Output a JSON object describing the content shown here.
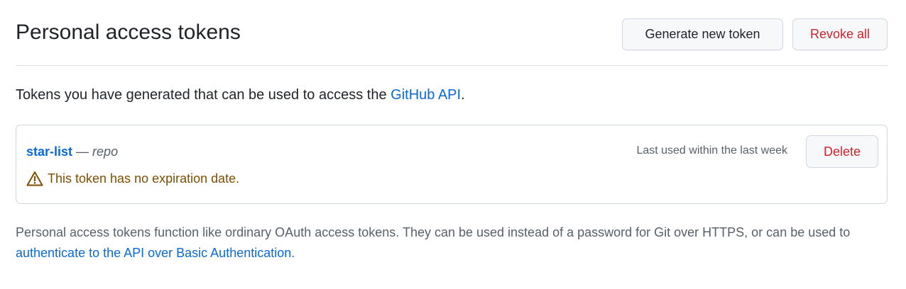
{
  "header": {
    "title": "Personal access tokens",
    "generate_label": "Generate new token",
    "revoke_label": "Revoke all"
  },
  "intro": {
    "text_before": "Tokens you have generated that can be used to access the ",
    "link_text": "GitHub API",
    "text_after": "."
  },
  "tokens": [
    {
      "name": "star-list",
      "separator": " — ",
      "scope": "repo",
      "last_used": "Last used within the last week",
      "delete_label": "Delete",
      "warning_icon": "alert-triangle-icon",
      "warning": "This token has no expiration date."
    }
  ],
  "footer": {
    "text_before": "Personal access tokens function like ordinary OAuth access tokens. They can be used instead of a password for Git over HTTPS, or can be used to ",
    "link_text": "authenticate to the API over Basic Authentication",
    "text_after": "."
  },
  "colors": {
    "link": "#0969da",
    "danger": "#cf222e",
    "warning": "#7d4e00",
    "muted": "#57606a",
    "border": "#d0d7de"
  }
}
